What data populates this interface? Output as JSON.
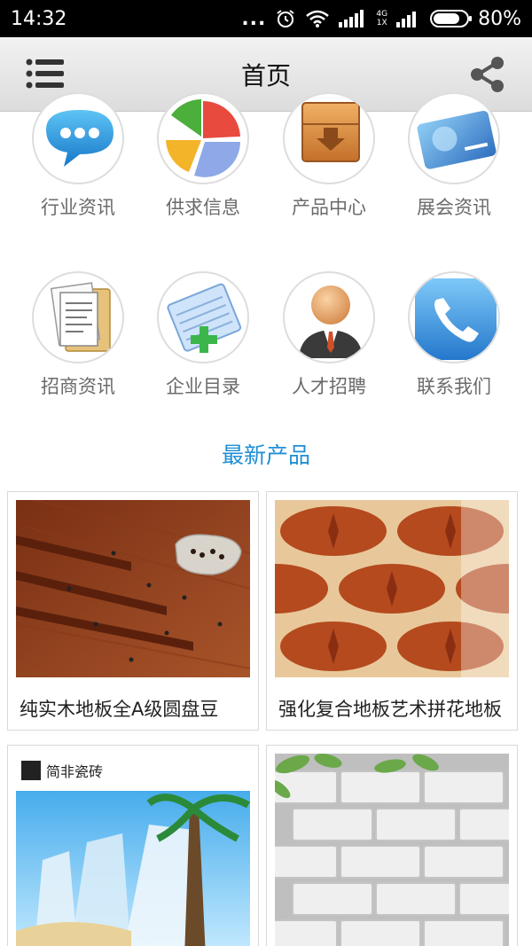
{
  "status_bar": {
    "time": "14:32",
    "dots": "...",
    "network_top": "4G",
    "network_bottom": "1X",
    "battery": "80%",
    "battery_level": 0.8
  },
  "header": {
    "title": "首页",
    "menu_icon": "list-menu-icon",
    "share_icon": "share-icon"
  },
  "categories": [
    {
      "label": "行业资讯",
      "icon": "chat-bubble-icon"
    },
    {
      "label": "供求信息",
      "icon": "pie-chart-icon"
    },
    {
      "label": "产品中心",
      "icon": "box-download-icon"
    },
    {
      "label": "展会资讯",
      "icon": "credit-card-icon"
    },
    {
      "label": "招商资讯",
      "icon": "documents-folder-icon"
    },
    {
      "label": "企业目录",
      "icon": "notepad-add-icon"
    },
    {
      "label": "人才招聘",
      "icon": "person-icon"
    },
    {
      "label": "联系我们",
      "icon": "phone-icon"
    }
  ],
  "section": {
    "title": "最新产品"
  },
  "products": [
    {
      "name": "纯实木地板全A级圆盘豆",
      "image": "dark-wood-flooring-with-beans"
    },
    {
      "name": "强化复合地板艺术拼花地板",
      "image": "parquet-star-pattern-floor"
    },
    {
      "name": "",
      "image": "tile-brand-beach-poster",
      "image_text": "简非瓷砖"
    },
    {
      "name": "",
      "image": "white-brick-wall-with-leaves"
    }
  ],
  "colors": {
    "accent": "#1f8fd6",
    "header_bg": "#e6e6e6",
    "status_bg": "#000000"
  }
}
